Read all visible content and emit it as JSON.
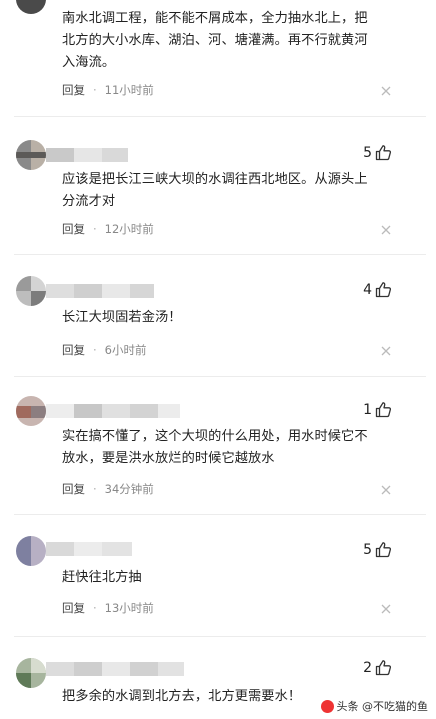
{
  "comments": [
    {
      "lines": [
        "南水北调工程，能不能不屑成本，全力抽水北上，把",
        "北方的大小水库、湖泊、河、塘灌满。再不行就黄河",
        "入海流。"
      ],
      "reply": "回复",
      "time": "11小时前",
      "likes": ""
    },
    {
      "lines": [
        "应该是把长江三峡大坝的水调往西北地区。从源头上",
        "分流才对"
      ],
      "reply": "回复",
      "time": "12小时前",
      "likes": "5"
    },
    {
      "lines": [
        "长江大坝固若金汤！"
      ],
      "reply": "回复",
      "time": "6小时前",
      "likes": "4"
    },
    {
      "lines": [
        "实在搞不懂了，这个大坝的什么用处，用水时候它不",
        "放水，要是洪水放烂的时候它越放水"
      ],
      "reply": "回复",
      "time": "34分钟前",
      "likes": "1"
    },
    {
      "lines": [
        "赶快往北方抽"
      ],
      "reply": "回复",
      "time": "13小时前",
      "likes": "5"
    },
    {
      "lines": [
        "把多余的水调到北方去，北方更需要水！"
      ],
      "reply": "回复",
      "time": "",
      "likes": "2"
    }
  ],
  "separator": "·",
  "watermark": "头条 @不吃猫的鱼",
  "icons": {
    "like": "thumbs-up-icon",
    "more": "close-x-icon",
    "avatar": "blurred-avatar"
  },
  "colors": {
    "text": "#222222",
    "meta": "#888888",
    "divider": "#ececec"
  }
}
